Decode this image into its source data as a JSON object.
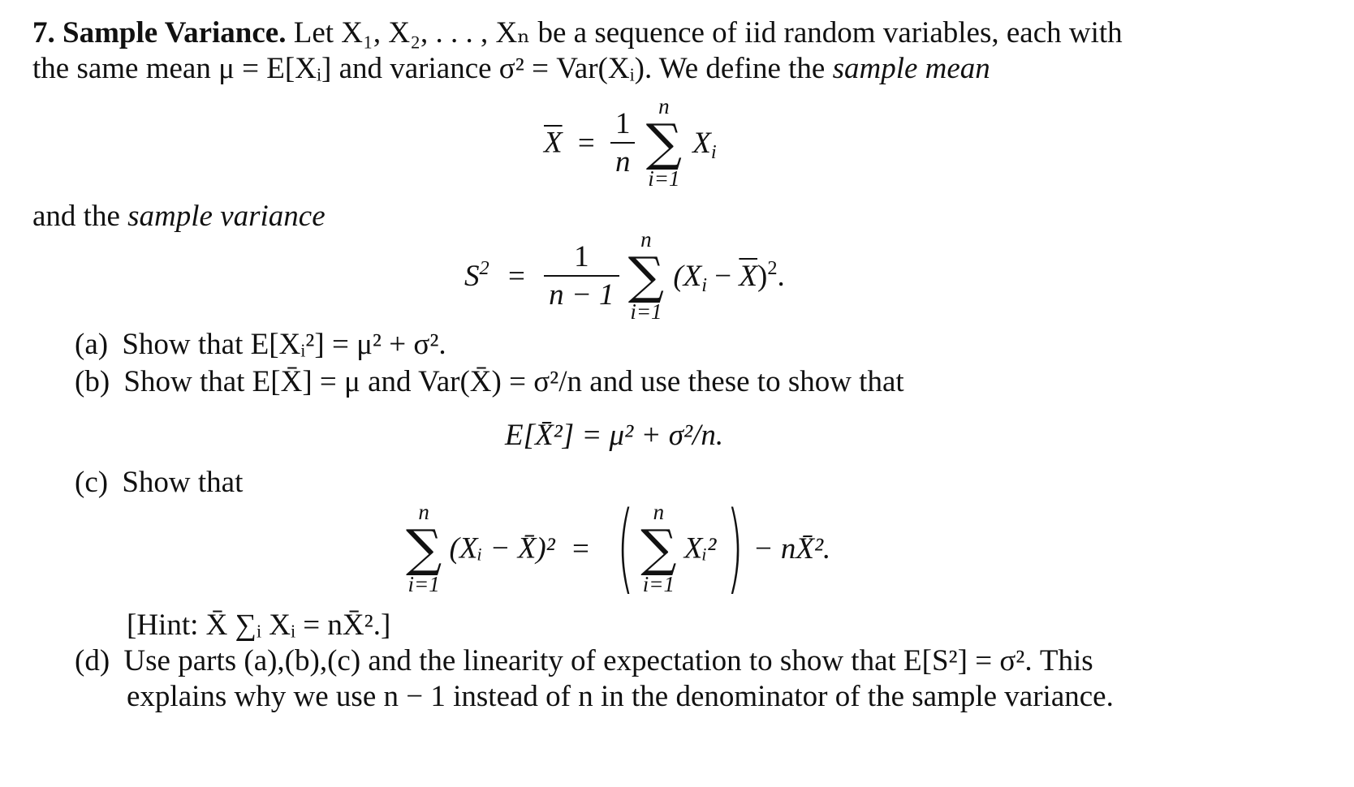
{
  "problem": {
    "number": "7.",
    "title": "Sample Variance.",
    "intro_line1_rest": "Let X₁, X₂, . . . , Xₙ be a sequence of iid random variables, each with",
    "intro_line2": "the same mean μ = E[Xᵢ] and variance σ² = Var(Xᵢ). We define the",
    "intro_line2_italic": "sample mean",
    "and_the": "and the",
    "sample_variance_italic": "sample variance"
  },
  "equations": {
    "sample_mean": {
      "lhs": "X",
      "eq": "=",
      "frac_num": "1",
      "frac_den": "n",
      "sum_upper": "n",
      "sum_lower": "i=1",
      "term": "X",
      "term_sub": "i"
    },
    "sample_variance": {
      "lhs": "S",
      "lhs_sup": "2",
      "eq": "=",
      "frac_num": "1",
      "frac_den": "n − 1",
      "sum_upper": "n",
      "sum_lower": "i=1",
      "term_open": "(X",
      "term_sub": "i",
      "term_minus": " − ",
      "term_bar": "X",
      "term_close": ")",
      "term_sup": "2",
      "period": "."
    },
    "part_b_display": "E[X̄²] = μ² + σ²/n.",
    "part_c_display": {
      "sum_upper": "n",
      "sum_lower": "i=1",
      "lhs_term": "(Xᵢ − X̄)²",
      "eq": "=",
      "inner_term": "Xᵢ²",
      "rhs_tail": "− nX̄²."
    }
  },
  "parts": [
    {
      "label": "(a)",
      "text": "Show that E[Xᵢ²] = μ² + σ²."
    },
    {
      "label": "(b)",
      "text": "Show that E[X̄] = μ and Var(X̄) = σ²/n and use these to show that"
    },
    {
      "label": "(c)",
      "text": "Show that"
    },
    {
      "label": "(d)",
      "text_line1": "Use parts (a),(b),(c) and the linearity of expectation to show that E[S²] = σ². This",
      "text_line2": "explains why we use n − 1 instead of n in the denominator of the sample variance."
    }
  ],
  "hint": "[Hint: X̄ ∑ᵢ Xᵢ = nX̄².]"
}
